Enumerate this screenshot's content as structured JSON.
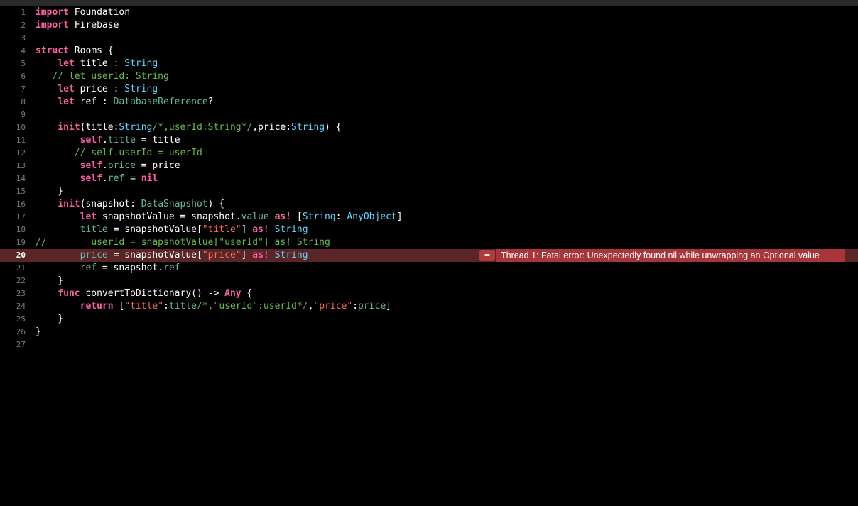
{
  "colors": {
    "background": "#000000",
    "keyword": "#fc5fa3",
    "type": "#5dd8ff",
    "comment": "#6ab84f",
    "string": "#fc6a5d",
    "error_line": "#5a2526",
    "error_badge": "#a8353a"
  },
  "error": {
    "line": 20,
    "icon": "equals-sign-error-icon",
    "icon_glyph": "=",
    "message": "Thread 1: Fatal error: Unexpectedly found nil while unwrapping an Optional value"
  },
  "lines": [
    {
      "n": "1",
      "segs": [
        {
          "t": "import",
          "c": "kw"
        },
        {
          "t": " Foundation",
          "c": "plain"
        }
      ]
    },
    {
      "n": "2",
      "segs": [
        {
          "t": "import",
          "c": "kw"
        },
        {
          "t": " Firebase",
          "c": "plain"
        }
      ]
    },
    {
      "n": "3",
      "segs": []
    },
    {
      "n": "4",
      "segs": [
        {
          "t": "struct",
          "c": "kw"
        },
        {
          "t": " Rooms {",
          "c": "plain"
        }
      ]
    },
    {
      "n": "5",
      "segs": [
        {
          "t": "    ",
          "c": "plain"
        },
        {
          "t": "let",
          "c": "kw"
        },
        {
          "t": " title : ",
          "c": "plain"
        },
        {
          "t": "String",
          "c": "type"
        }
      ]
    },
    {
      "n": "6",
      "segs": [
        {
          "t": "   // let userId: String",
          "c": "comment"
        }
      ]
    },
    {
      "n": "7",
      "segs": [
        {
          "t": "    ",
          "c": "plain"
        },
        {
          "t": "let",
          "c": "kw"
        },
        {
          "t": " price : ",
          "c": "plain"
        },
        {
          "t": "String",
          "c": "type"
        }
      ]
    },
    {
      "n": "8",
      "segs": [
        {
          "t": "    ",
          "c": "plain"
        },
        {
          "t": "let",
          "c": "kw"
        },
        {
          "t": " ref : ",
          "c": "plain"
        },
        {
          "t": "DatabaseReference",
          "c": "proj"
        },
        {
          "t": "?",
          "c": "plain"
        }
      ]
    },
    {
      "n": "9",
      "segs": []
    },
    {
      "n": "10",
      "segs": [
        {
          "t": "    ",
          "c": "plain"
        },
        {
          "t": "init",
          "c": "kw"
        },
        {
          "t": "(title:",
          "c": "plain"
        },
        {
          "t": "String",
          "c": "type"
        },
        {
          "t": "/*,userId:String*/",
          "c": "comment"
        },
        {
          "t": ",price:",
          "c": "plain"
        },
        {
          "t": "String",
          "c": "type"
        },
        {
          "t": ") {",
          "c": "plain"
        }
      ]
    },
    {
      "n": "11",
      "segs": [
        {
          "t": "        ",
          "c": "plain"
        },
        {
          "t": "self",
          "c": "kw"
        },
        {
          "t": ".",
          "c": "plain"
        },
        {
          "t": "title",
          "c": "proj"
        },
        {
          "t": " = title",
          "c": "plain"
        }
      ]
    },
    {
      "n": "12",
      "segs": [
        {
          "t": "       // self.userId = userId",
          "c": "comment"
        }
      ]
    },
    {
      "n": "13",
      "segs": [
        {
          "t": "        ",
          "c": "plain"
        },
        {
          "t": "self",
          "c": "kw"
        },
        {
          "t": ".",
          "c": "plain"
        },
        {
          "t": "price",
          "c": "proj"
        },
        {
          "t": " = price",
          "c": "plain"
        }
      ]
    },
    {
      "n": "14",
      "segs": [
        {
          "t": "        ",
          "c": "plain"
        },
        {
          "t": "self",
          "c": "kw"
        },
        {
          "t": ".",
          "c": "plain"
        },
        {
          "t": "ref",
          "c": "proj"
        },
        {
          "t": " = ",
          "c": "plain"
        },
        {
          "t": "nil",
          "c": "kw"
        }
      ]
    },
    {
      "n": "15",
      "segs": [
        {
          "t": "    }",
          "c": "plain"
        }
      ]
    },
    {
      "n": "16",
      "segs": [
        {
          "t": "    ",
          "c": "plain"
        },
        {
          "t": "init",
          "c": "kw"
        },
        {
          "t": "(snapshot: ",
          "c": "plain"
        },
        {
          "t": "DataSnapshot",
          "c": "proj"
        },
        {
          "t": ") {",
          "c": "plain"
        }
      ]
    },
    {
      "n": "17",
      "segs": [
        {
          "t": "        ",
          "c": "plain"
        },
        {
          "t": "let",
          "c": "kw"
        },
        {
          "t": " snapshotValue = snapshot.",
          "c": "plain"
        },
        {
          "t": "value",
          "c": "proj"
        },
        {
          "t": " ",
          "c": "plain"
        },
        {
          "t": "as!",
          "c": "kw"
        },
        {
          "t": " [",
          "c": "plain"
        },
        {
          "t": "String",
          "c": "type"
        },
        {
          "t": ": ",
          "c": "plain"
        },
        {
          "t": "AnyObject",
          "c": "type"
        },
        {
          "t": "]",
          "c": "plain"
        }
      ]
    },
    {
      "n": "18",
      "segs": [
        {
          "t": "        ",
          "c": "plain"
        },
        {
          "t": "title",
          "c": "proj"
        },
        {
          "t": " = snapshotValue[",
          "c": "plain"
        },
        {
          "t": "\"title\"",
          "c": "str"
        },
        {
          "t": "] ",
          "c": "plain"
        },
        {
          "t": "as!",
          "c": "kw"
        },
        {
          "t": " ",
          "c": "plain"
        },
        {
          "t": "String",
          "c": "type"
        }
      ]
    },
    {
      "n": "19",
      "segs": [
        {
          "t": "//        userId = snapshotValue[\"userId\"] as! String",
          "c": "comment"
        }
      ]
    },
    {
      "n": "20",
      "segs": [
        {
          "t": "        ",
          "c": "plain"
        },
        {
          "t": "price",
          "c": "proj"
        },
        {
          "t": " = snapshotValue[",
          "c": "plain"
        },
        {
          "t": "\"price\"",
          "c": "str"
        },
        {
          "t": "] ",
          "c": "plain"
        },
        {
          "t": "as!",
          "c": "kw"
        },
        {
          "t": " ",
          "c": "plain"
        },
        {
          "t": "String",
          "c": "type"
        }
      ]
    },
    {
      "n": "21",
      "segs": [
        {
          "t": "        ",
          "c": "plain"
        },
        {
          "t": "ref",
          "c": "proj"
        },
        {
          "t": " = snapshot.",
          "c": "plain"
        },
        {
          "t": "ref",
          "c": "proj"
        }
      ]
    },
    {
      "n": "22",
      "segs": [
        {
          "t": "    }",
          "c": "plain"
        }
      ]
    },
    {
      "n": "23",
      "segs": [
        {
          "t": "    ",
          "c": "plain"
        },
        {
          "t": "func",
          "c": "kw"
        },
        {
          "t": " convertToDictionary() -> ",
          "c": "plain"
        },
        {
          "t": "Any",
          "c": "kw"
        },
        {
          "t": " {",
          "c": "plain"
        }
      ]
    },
    {
      "n": "24",
      "segs": [
        {
          "t": "        ",
          "c": "plain"
        },
        {
          "t": "return",
          "c": "kw"
        },
        {
          "t": " [",
          "c": "plain"
        },
        {
          "t": "\"title\"",
          "c": "str"
        },
        {
          "t": ":",
          "c": "plain"
        },
        {
          "t": "title",
          "c": "proj"
        },
        {
          "t": "/*,\"userId\":userId*/",
          "c": "comment"
        },
        {
          "t": ",",
          "c": "plain"
        },
        {
          "t": "\"price\"",
          "c": "str"
        },
        {
          "t": ":",
          "c": "plain"
        },
        {
          "t": "price",
          "c": "proj"
        },
        {
          "t": "]",
          "c": "plain"
        }
      ]
    },
    {
      "n": "25",
      "segs": [
        {
          "t": "    }",
          "c": "plain"
        }
      ]
    },
    {
      "n": "26",
      "segs": [
        {
          "t": "}",
          "c": "plain"
        }
      ]
    },
    {
      "n": "27",
      "segs": []
    }
  ]
}
